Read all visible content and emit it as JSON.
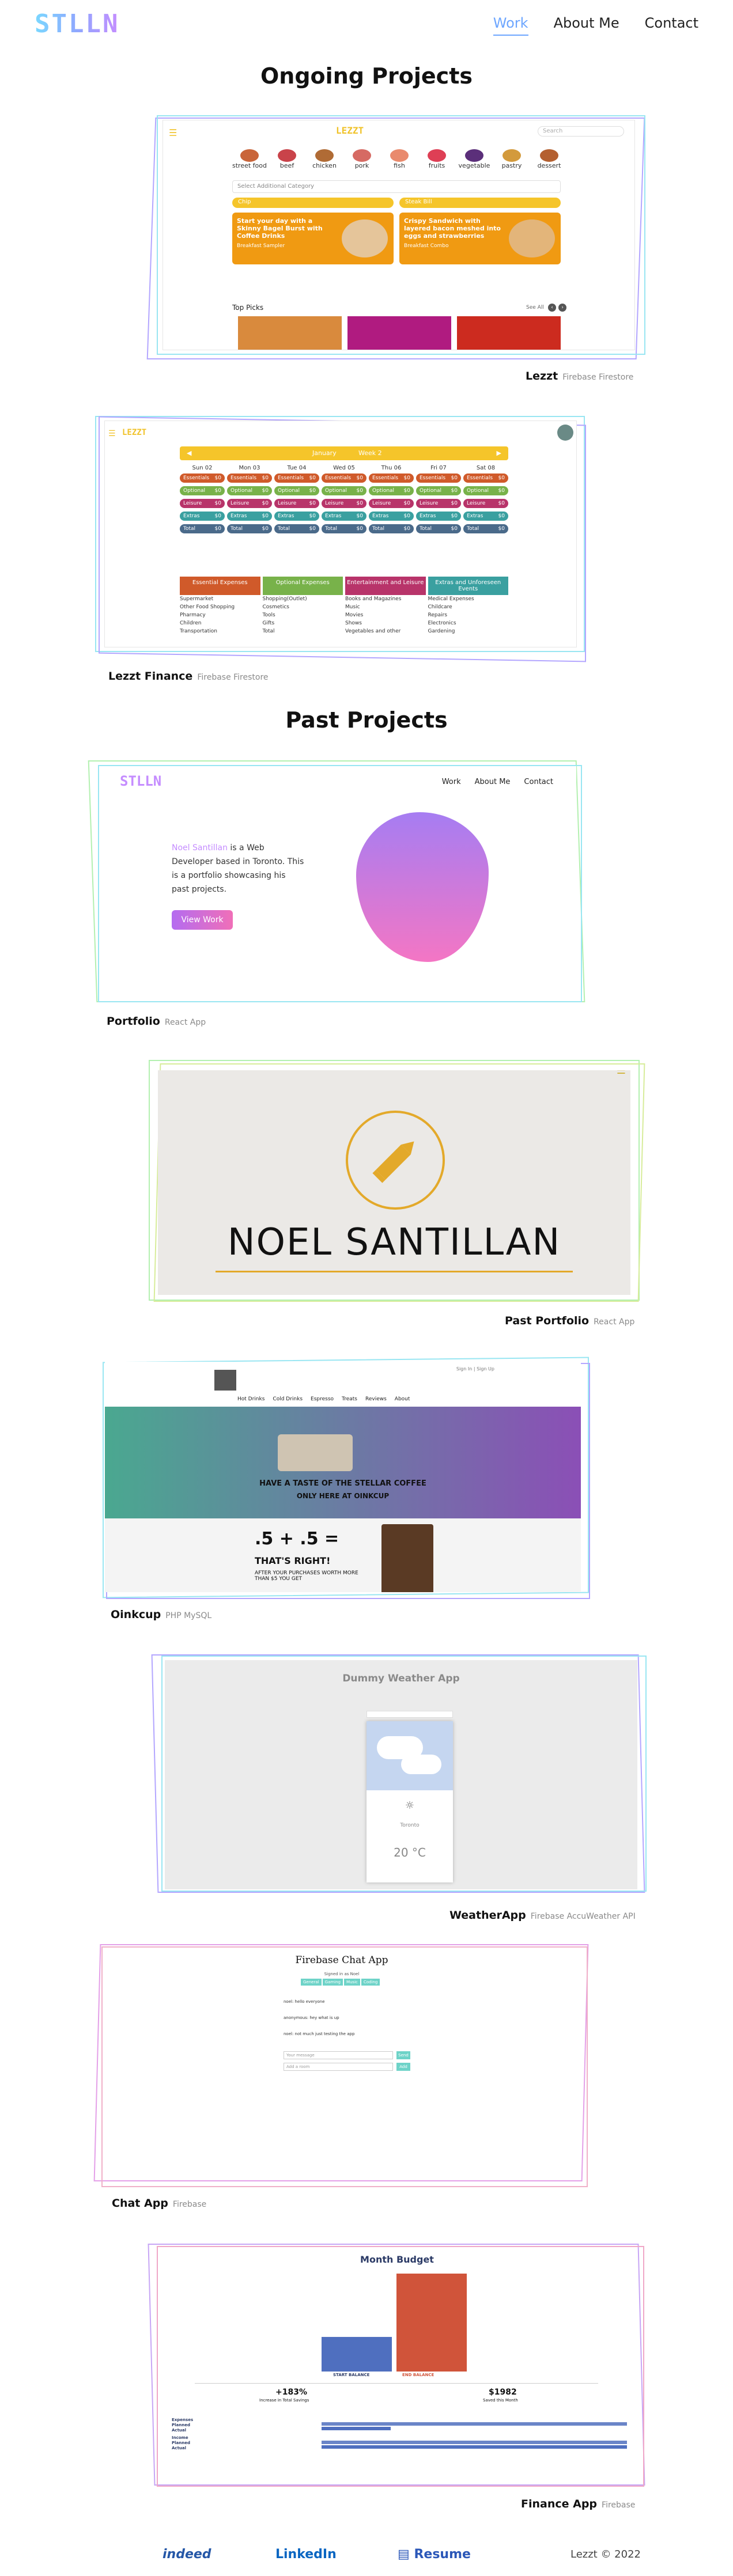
{
  "nav": {
    "logo": "STLLN",
    "links": [
      "Work",
      "About Me",
      "Contact"
    ]
  },
  "sections": {
    "ongoing": "Ongoing Projects",
    "past": "Past Projects"
  },
  "projects": [
    {
      "name": "Lezzt",
      "tech": "Firebase Firestore"
    },
    {
      "name": "Lezzt Finance",
      "tech": "Firebase Firestore"
    },
    {
      "name": "Portfolio",
      "tech": "React App"
    },
    {
      "name": "Past Portfolio",
      "tech": "React App"
    },
    {
      "name": "Oinkcup",
      "tech": "PHP MySQL"
    },
    {
      "name": "WeatherApp",
      "tech": "Firebase AccuWeather API"
    },
    {
      "name": "Chat App",
      "tech": "Firebase"
    },
    {
      "name": "Finance App",
      "tech": "Firebase"
    }
  ],
  "lezzt": {
    "logo": "LEZZT",
    "search": "Search",
    "categories": [
      "street food",
      "beef",
      "chicken",
      "pork",
      "fish",
      "fruits",
      "vegetable",
      "pastry",
      "dessert"
    ],
    "select": "Select Additional Category",
    "bar1": "Chip",
    "bar2": "Steak Bill",
    "card1": "Start your day with a Skinny Bagel Burst with Coffee Drinks",
    "card1_sub": "Breakfast Sampler",
    "card2": "Crispy Sandwich with layered bacon meshed into eggs and strawberries",
    "card2_sub": "Breakfast Combo",
    "top_picks": "Top Picks",
    "see_all": "See All"
  },
  "finance": {
    "logo": "LEZZT",
    "month": "January",
    "week": "Week 2",
    "days": [
      "Sun 02",
      "Mon 03",
      "Tue 04",
      "Wed 05",
      "Thu 06",
      "Fri 07",
      "Sat 08"
    ],
    "rows": [
      "Essentials",
      "Optional",
      "Leisure",
      "Extras",
      "Total"
    ],
    "row_val": "$0",
    "groups": [
      "Essential Expenses",
      "Optional Expenses",
      "Entertainment and Leisure",
      "Extras and Unforeseen Events"
    ],
    "items": [
      [
        "Supermarket",
        "Other Food Shopping",
        "Pharmacy",
        "Children",
        "Transportation"
      ],
      [
        "Shopping(Outlet)",
        "Cosmetics",
        "Tools",
        "Gifts",
        "Total"
      ],
      [
        "Books and Magazines",
        "Music",
        "Movies",
        "Shows",
        "Vegetables and other"
      ],
      [
        "Medical Expenses",
        "Childcare",
        "Repairs",
        "Electronics",
        "Gardening"
      ]
    ]
  },
  "portfolio": {
    "logo": "STLLN",
    "links": [
      "Work",
      "About Me",
      "Contact"
    ],
    "name": "Noel Santillan",
    "intro": "is a Web Developer based in Toronto. This is a portfolio showcasing his past projects.",
    "button": "View Work"
  },
  "past_portfolio": {
    "title": "NOEL SANTILLAN"
  },
  "oinkcup": {
    "topbar": "Sign In | Sign Up",
    "menu": [
      "Hot Drinks",
      "Cold Drinks",
      "Espresso",
      "Treats",
      "Reviews",
      "About"
    ],
    "banner1": "HAVE A TASTE OF THE STELLAR COFFEE",
    "banner2": "ONLY HERE AT OINKCUP",
    "promo": ".5 + .5 =",
    "promo2": "THAT'S RIGHT!",
    "promo3": "AFTER YOUR PURCHASES WORTH MORE THAN $5 YOU GET"
  },
  "weather": {
    "title": "Dummy Weather App",
    "city": "Toronto",
    "temp": "20 °C"
  },
  "chat": {
    "title": "Firebase Chat App",
    "signed": "Signed in as Noel",
    "rooms": [
      "General",
      "Gaming",
      "Music",
      "Coding"
    ],
    "messages": [
      "noel: hello everyone",
      "anonymous: hey what is up",
      "noel: not much just testing the app"
    ],
    "input1": "Your message",
    "input2": "Add a room",
    "send": "Send",
    "add": "Add"
  },
  "budget": {
    "title": "Month Budget",
    "start_label": "START BALANCE",
    "end_label": "END BALANCE",
    "savings_pct": "+183%",
    "savings_label": "Increase in Total Savings",
    "saved": "$1982",
    "saved_label": "Saved this Month",
    "rows": [
      "Expenses",
      "Planned",
      "Actual",
      "Income",
      "Planned",
      "Actual"
    ],
    "start_value": 700,
    "end_value": 1982,
    "colors": {
      "start": "#4f6fbf",
      "end": "#d0543a"
    }
  },
  "footer": {
    "indeed": "indeed",
    "linkedin": "LinkedIn",
    "resume": "Resume",
    "copyright": "Lezzt © 2022"
  }
}
